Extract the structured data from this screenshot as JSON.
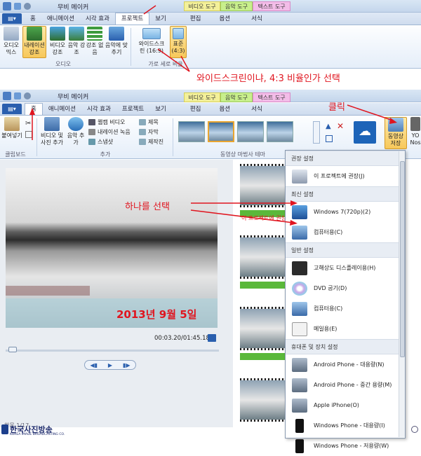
{
  "top_window": {
    "title": "무비 메이커",
    "context_tabs": [
      "비디오 도구",
      "음악 도구",
      "텍스트 도구"
    ],
    "tabs": [
      "홈",
      "애니메이션",
      "시각 효과",
      "프로젝트",
      "보기",
      "편집",
      "옵션",
      "서식"
    ],
    "audio_group": {
      "buttons": [
        "오디오 믹스",
        "내레이션 강조",
        "비디오 강조",
        "음악 강조",
        "강조 없음",
        "음악에 맞추기"
      ],
      "label": "오디오"
    },
    "aspect_group": {
      "buttons": [
        "와이드스크린 (16:9)",
        "표준 (4:3)"
      ],
      "label": "가로 세로 비율"
    }
  },
  "annotations": {
    "widescreen": "와이드스크린이냐, 4:3 비율인가 선택",
    "click": "클릭",
    "choose_one": "하나를 선택"
  },
  "main_window": {
    "title": "무비 메이커",
    "context_tabs": [
      "비디오 도구",
      "음악 도구",
      "텍스트 도구"
    ],
    "tabs": [
      "홈",
      "애니메이션",
      "시각 효과",
      "프로젝트",
      "보기",
      "편집",
      "옵션",
      "서식"
    ],
    "ribbon": {
      "paste": "붙여넣기",
      "clipboard_label": "클립보드",
      "add_video": "비디오 및 사진 추가",
      "add_music": "음악 추가",
      "webcam": "웹캠 비디오",
      "narration": "내레이션 녹음",
      "snapshot": "스냅샷",
      "title": "제목",
      "caption": "자막",
      "credits": "제작진",
      "add_label": "추가",
      "themes_label": "동영상 마법사 테마",
      "save_movie": "동영상 저장",
      "yo": "YO",
      "nos": "Nos"
    },
    "preview": {
      "overlay_text": "2013년 9월 5일",
      "timecode": "00:03.20/01:45.18"
    },
    "status_text": "항목 1/17",
    "watermark": "한국사진방송",
    "watermark_sub": "KOREA IMAGE BROADCASTING CO."
  },
  "save_menu": {
    "sections": [
      {
        "header": "권장 설정",
        "items": [
          "이 프로젝트에 권장(J)"
        ]
      },
      {
        "header": "최신 설정",
        "items": [
          "Windows 7(720p)(2)",
          "컴퓨터용(C)"
        ]
      },
      {
        "header": "일반 설정",
        "items": [
          "고해상도 디스플레이용(H)",
          "DVD 굽기(D)",
          "컴퓨터용(C)",
          "메일용(E)"
        ]
      },
      {
        "header": "휴대폰 및 장치 설정",
        "items": [
          "Android Phone - 대용량(N)",
          "Android Phone - 중간 용량(M)",
          "Apple iPhone(O)",
          "Windows Phone - 대용량(I)",
          "Windows Phone - 저용량(W)"
        ]
      }
    ],
    "overlay_text": "이 프로젝트에 권장"
  },
  "colors": {
    "accent_red": "#e0151f",
    "ribbon_blue": "#2a5fae",
    "video_tool": "#f3f09a",
    "music_tool": "#c8ef8c",
    "text_tool": "#f3bde8"
  }
}
